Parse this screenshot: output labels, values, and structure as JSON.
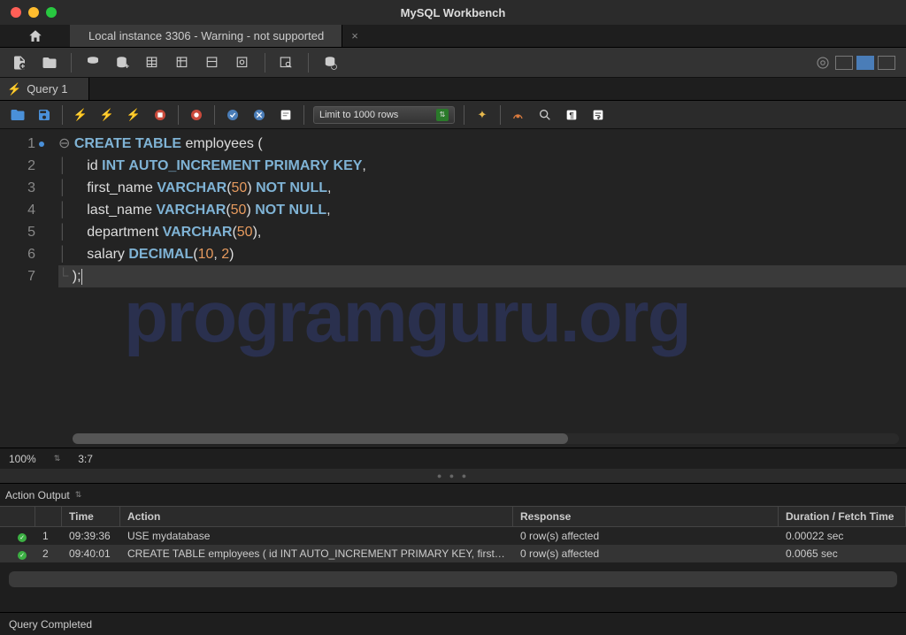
{
  "title": "MySQL Workbench",
  "connection_tab": "Local instance 3306 - Warning - not supported",
  "query_tab": "Query 1",
  "limit_select": "Limit to 1000 rows",
  "editor": {
    "lines": [
      {
        "n": "1",
        "seg": [
          {
            "t": "CREATE",
            "c": "kw"
          },
          {
            "t": " ",
            "c": "pn"
          },
          {
            "t": "TABLE",
            "c": "kw"
          },
          {
            "t": " ",
            "c": "pn"
          },
          {
            "t": "employees",
            "c": "id"
          },
          {
            "t": " (",
            "c": "pn"
          }
        ]
      },
      {
        "n": "2",
        "seg": [
          {
            "t": "    id ",
            "c": "id"
          },
          {
            "t": "INT",
            "c": "ty"
          },
          {
            "t": " ",
            "c": "pn"
          },
          {
            "t": "AUTO_INCREMENT",
            "c": "ty"
          },
          {
            "t": " ",
            "c": "pn"
          },
          {
            "t": "PRIMARY",
            "c": "kw"
          },
          {
            "t": " ",
            "c": "pn"
          },
          {
            "t": "KEY",
            "c": "kw"
          },
          {
            "t": ",",
            "c": "pn"
          }
        ]
      },
      {
        "n": "3",
        "seg": [
          {
            "t": "    first_name ",
            "c": "id"
          },
          {
            "t": "VARCHAR",
            "c": "ty"
          },
          {
            "t": "(",
            "c": "pn"
          },
          {
            "t": "50",
            "c": "num"
          },
          {
            "t": ") ",
            "c": "pn"
          },
          {
            "t": "NOT",
            "c": "kw"
          },
          {
            "t": " ",
            "c": "pn"
          },
          {
            "t": "NULL",
            "c": "kw"
          },
          {
            "t": ",",
            "c": "pn"
          }
        ]
      },
      {
        "n": "4",
        "seg": [
          {
            "t": "    last_name ",
            "c": "id"
          },
          {
            "t": "VARCHAR",
            "c": "ty"
          },
          {
            "t": "(",
            "c": "pn"
          },
          {
            "t": "50",
            "c": "num"
          },
          {
            "t": ") ",
            "c": "pn"
          },
          {
            "t": "NOT",
            "c": "kw"
          },
          {
            "t": " ",
            "c": "pn"
          },
          {
            "t": "NULL",
            "c": "kw"
          },
          {
            "t": ",",
            "c": "pn"
          }
        ]
      },
      {
        "n": "5",
        "seg": [
          {
            "t": "    department ",
            "c": "id"
          },
          {
            "t": "VARCHAR",
            "c": "ty"
          },
          {
            "t": "(",
            "c": "pn"
          },
          {
            "t": "50",
            "c": "num"
          },
          {
            "t": "),",
            "c": "pn"
          }
        ]
      },
      {
        "n": "6",
        "seg": [
          {
            "t": "    salary ",
            "c": "id"
          },
          {
            "t": "DECIMAL",
            "c": "ty"
          },
          {
            "t": "(",
            "c": "pn"
          },
          {
            "t": "10",
            "c": "num"
          },
          {
            "t": ", ",
            "c": "pn"
          },
          {
            "t": "2",
            "c": "num"
          },
          {
            "t": ")",
            "c": "pn"
          }
        ]
      },
      {
        "n": "7",
        "seg": [
          {
            "t": ");",
            "c": "pn"
          }
        ]
      }
    ],
    "zoom": "100%",
    "cursor_pos": "3:7"
  },
  "watermark": "programguru.org",
  "output": {
    "label": "Action Output",
    "headers": {
      "time": "Time",
      "action": "Action",
      "response": "Response",
      "duration": "Duration / Fetch Time"
    },
    "rows": [
      {
        "idx": "1",
        "time": "09:39:36",
        "action": "USE mydatabase",
        "response": "0 row(s) affected",
        "duration": "0.00022 sec"
      },
      {
        "idx": "2",
        "time": "09:40:01",
        "action": "CREATE TABLE employees (     id INT AUTO_INCREMENT PRIMARY KEY,     first_n…",
        "response": "0 row(s) affected",
        "duration": "0.0065 sec"
      }
    ]
  },
  "status": "Query Completed"
}
